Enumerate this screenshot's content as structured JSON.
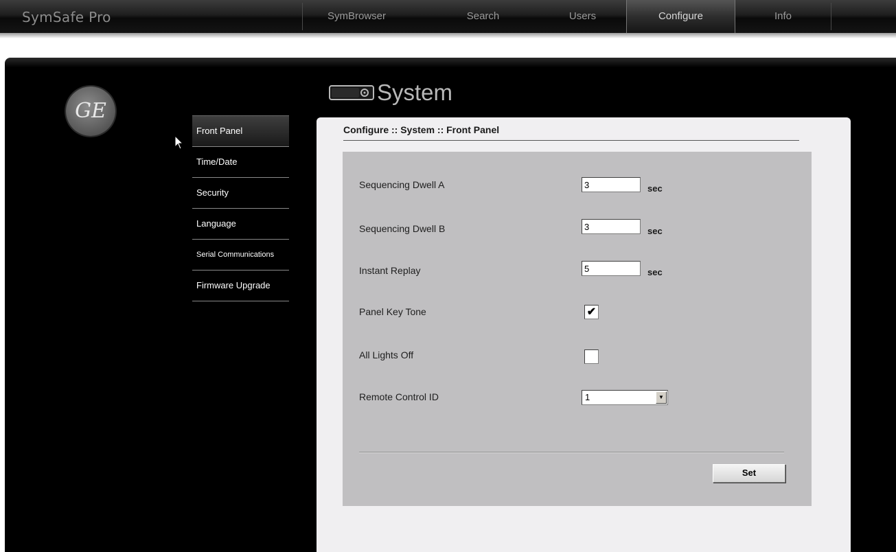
{
  "app": {
    "title": "SymSafe Pro"
  },
  "nav": {
    "tabs": [
      {
        "label": "SymBrowser",
        "active": false
      },
      {
        "label": "Search",
        "active": false
      },
      {
        "label": "Users",
        "active": false
      },
      {
        "label": "Configure",
        "active": true
      },
      {
        "label": "Info",
        "active": false
      }
    ]
  },
  "logo": {
    "text": "GE",
    "icon": "ge-logo"
  },
  "page": {
    "title": "System",
    "icon": "system-device-icon"
  },
  "sidebar": {
    "items": [
      {
        "label": "Front Panel",
        "active": true
      },
      {
        "label": "Time/Date",
        "active": false
      },
      {
        "label": "Security",
        "active": false
      },
      {
        "label": "Language",
        "active": false
      },
      {
        "label": "Serial Communications",
        "active": false
      },
      {
        "label": "Firmware Upgrade",
        "active": false
      }
    ]
  },
  "content": {
    "breadcrumb": "Configure :: System :: Front Panel",
    "fields": {
      "dwell_a": {
        "label": "Sequencing Dwell A",
        "value": "3",
        "unit": "sec"
      },
      "dwell_b": {
        "label": "Sequencing Dwell B",
        "value": "3",
        "unit": "sec"
      },
      "instant_replay": {
        "label": "Instant Replay",
        "value": "5",
        "unit": "sec"
      },
      "panel_key_tone": {
        "label": "Panel Key Tone",
        "checked": true,
        "mark": "✔"
      },
      "all_lights_off": {
        "label": "All Lights Off",
        "checked": false,
        "mark": ""
      },
      "remote_control_id": {
        "label": "Remote Control ID",
        "value": "1"
      }
    },
    "set_label": "Set"
  },
  "colors": {
    "nav_bg": "#141414",
    "panel_bg": "#000000",
    "card_bg": "#f0eff1",
    "form_bg": "#c0bfc1"
  }
}
